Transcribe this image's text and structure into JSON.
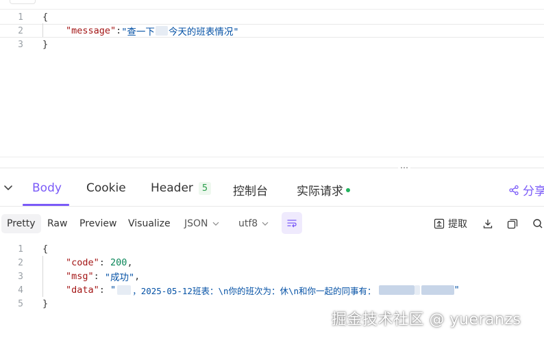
{
  "request": {
    "lines": [
      {
        "n": "1",
        "text": "{"
      },
      {
        "n": "2",
        "key": "\"message\"",
        "sep": ":",
        "value_before": "\"查一下",
        "value_after": "今天的班表情况\""
      },
      {
        "n": "3",
        "text": "}"
      }
    ]
  },
  "splitter": {
    "grip": "⋯"
  },
  "response_tabs": {
    "body": "Body",
    "cookie": "Cookie",
    "header": "Header",
    "header_count": "5",
    "console": "控制台",
    "actual_request": "实际请求",
    "share": "分享"
  },
  "toolbar": {
    "pretty": "Pretty",
    "raw": "Raw",
    "preview": "Preview",
    "visualize": "Visualize",
    "format_select": "JSON",
    "encoding_select": "utf8",
    "extract": "提取"
  },
  "response": {
    "lines": [
      {
        "n": "1",
        "text": "{"
      },
      {
        "n": "2",
        "key": "\"code\"",
        "sep": ": ",
        "value": "200",
        "tail": ","
      },
      {
        "n": "3",
        "key": "\"msg\"",
        "sep": ": ",
        "value": "\"成功\"",
        "tail": ","
      },
      {
        "n": "4",
        "key": "\"data\"",
        "sep": ": ",
        "value_start": "\"",
        "value_mid": "，2025-05-12班表：\\n你的班次为：休\\n和你一起的同事有：",
        "value_end": "\""
      },
      {
        "n": "5",
        "text": "}"
      }
    ]
  },
  "watermark": "掘金技术社区 @ yueranzs",
  "colors": {
    "accent": "#7a5af8",
    "string": "#0451a5",
    "key": "#a31515",
    "number": "#098658",
    "status_green": "#22b35e"
  }
}
